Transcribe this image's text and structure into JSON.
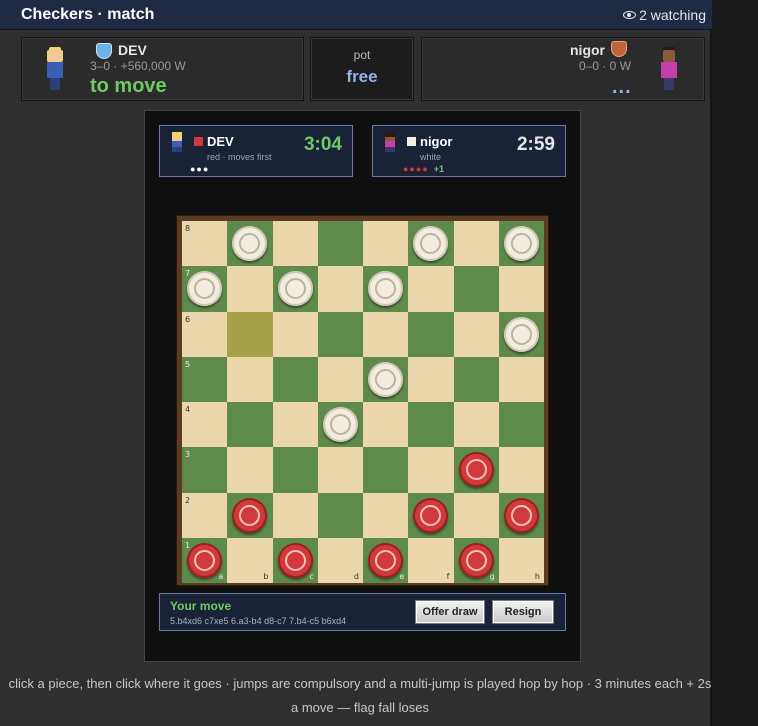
{
  "header": {
    "title": "Checkers · match",
    "watching": "2 watching",
    "eye_icon": "eye-icon"
  },
  "left_player": {
    "name": "DEV",
    "stats": "3–0 · +560,000 W",
    "status": "to move",
    "badge_color": "#6db3e8"
  },
  "pot": {
    "label": "pot",
    "value": "free"
  },
  "right_player": {
    "name": "nigor",
    "stats": "0–0 · 0 W",
    "status": "...",
    "badge_color": "#c0653a"
  },
  "clocks": {
    "dev": {
      "name": "DEV",
      "sub": "red · moves first",
      "time": "3:04",
      "pips": "●●●",
      "color": "#d13a3a",
      "time_color": "#6ecb63"
    },
    "nigor": {
      "name": "nigor",
      "sub": "white",
      "time": "2:59",
      "pips": "●●●●",
      "advantage": "+1",
      "color": "#f2ede0",
      "time_color": "#e6e6e6"
    }
  },
  "board": {
    "files": [
      "a",
      "b",
      "c",
      "d",
      "e",
      "f",
      "g",
      "h"
    ],
    "ranks": [
      "8",
      "7",
      "6",
      "5",
      "4",
      "3",
      "2",
      "1"
    ],
    "highlight": [
      "b6"
    ],
    "pieces": {
      "b8": "white",
      "f8": "white",
      "h8": "white",
      "a7": "white",
      "c7": "white",
      "e7": "white",
      "h6": "white",
      "e5": "white",
      "d4": "white",
      "g3": "red",
      "b2": "red",
      "f2": "red",
      "h2": "red",
      "a1": "red",
      "c1": "red",
      "e1": "red",
      "g1": "red"
    },
    "light_color": "#ecd7ac",
    "dark_color": "#5e8a4c"
  },
  "status": {
    "title": "Your move",
    "moves": "5.b4xd6 c7xe5 6.a3-b4 d8-c7 7.b4-c5 b6xd4",
    "draw_label": "Offer draw",
    "resign_label": "Resign"
  },
  "footer": "click a piece, then click where it goes · jumps are compulsory and a multi-jump is played hop by hop · 3 minutes each + 2s a move — flag fall loses"
}
